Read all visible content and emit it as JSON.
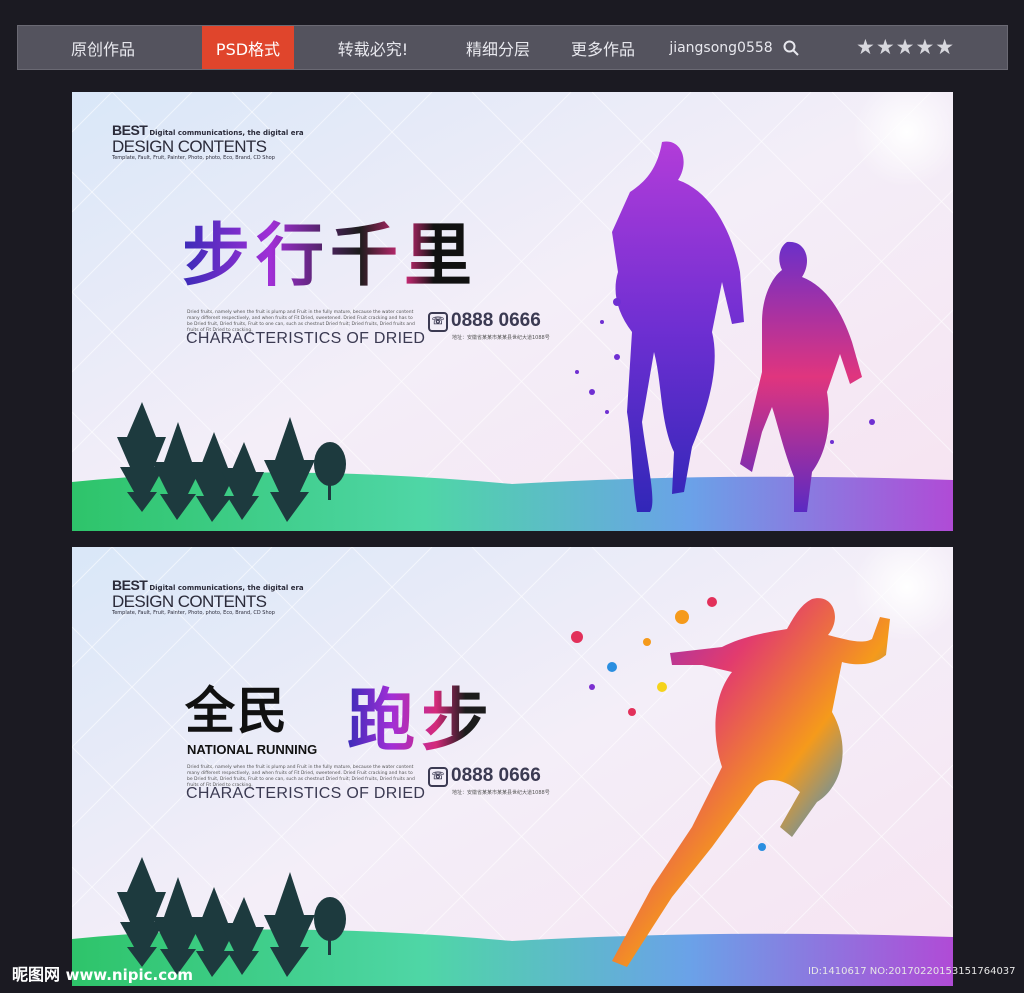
{
  "nav": {
    "items": [
      {
        "label": "原创作品"
      },
      {
        "label": "PSD格式"
      },
      {
        "label": "转载必究!"
      },
      {
        "label": "精细分层"
      },
      {
        "label": "更多作品"
      },
      {
        "label": "jiangsong0558"
      }
    ],
    "rating": "★★★★★"
  },
  "banner1": {
    "brand": {
      "best": "BEST",
      "tagline": "Digital communications, the digital era",
      "design_contents": "DESIGN CONTENTS",
      "small": "Template, Fault, Fruit, Painter, Photo, photo, Eco, Brand, CD Shop"
    },
    "headline": "步行千里",
    "paragraph": "Dried fruits, namely when the fruit is plump and Fruit in the fully mature, because the water content many different respectively, and when fruits of Fit Dried, sweetened. Dried Fruit cracking and has to be Dried fruit, Dried fruits, Fruit to one can, such as chestnut Dried fruit; Dried fruits, Dried fruits and fruits of Fit Dried to cracking.",
    "characteristics": "CHARACTERISTICS OF DRIED",
    "phone": "0888 0666",
    "address": "地址：安徽省某某市某某县世纪大道1088号"
  },
  "banner2": {
    "brand": {
      "best": "BEST",
      "tagline": "Digital communications, the digital era",
      "design_contents": "DESIGN CONTENTS",
      "small": "Template, Fault, Fruit, Painter, Photo, photo, Eco, Brand, CD Shop"
    },
    "headline_block": "全民",
    "headline": "跑步",
    "national": "NATIONAL RUNNING",
    "paragraph": "Dried fruits, namely when the fruit is plump and Fruit in the fully mature, because the water content many different respectively, and when fruits of Fit Dried, sweetened. Dried Fruit cracking and has to be Dried fruit, Dried fruits, Fruit to one can, such as chestnut Dried fruit; Dried fruits, Dried fruits and fruits of Fit Dried to cracking.",
    "characteristics": "CHARACTERISTICS OF DRIED",
    "phone": "0888 0666",
    "address": "地址：安徽省某某市某某县世纪大道1088号"
  },
  "watermark": {
    "site_name": "昵图网",
    "url": "www.nipic.com",
    "id": "ID:1410617 NO:20170220153151764037"
  },
  "colors": {
    "nav_bg": "#54535e",
    "nav_active": "#e0452c",
    "page_bg": "#1b1a22",
    "accent_purple": "#7a2fd0",
    "accent_magenta": "#d4237a"
  }
}
